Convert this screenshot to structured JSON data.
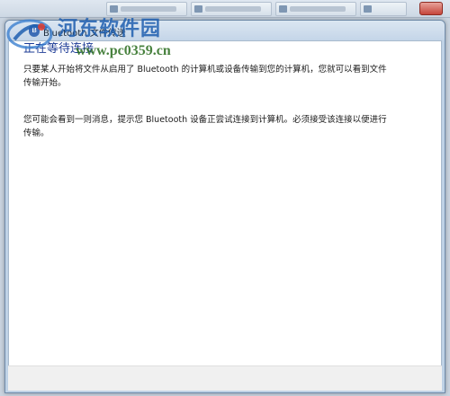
{
  "window": {
    "title": "Bluetooth 文件传送",
    "icon": "bluetooth-icon"
  },
  "content": {
    "heading": "正在等待连接",
    "paragraph1": "只要某人开始将文件从启用了 Bluetooth 的计算机或设备传输到您的计算机，您就可以看到文件传输开始。",
    "paragraph2": "您可能会看到一则消息，提示您 Bluetooth 设备正尝试连接到计算机。必须接受该连接以便进行传输。"
  },
  "watermark": {
    "name": "河东软件园",
    "url": "www.pc0359.cn"
  },
  "colors": {
    "heading": "#1e3c96",
    "watermark_name": "#1f5fb0",
    "watermark_url": "#2a6d1e"
  }
}
